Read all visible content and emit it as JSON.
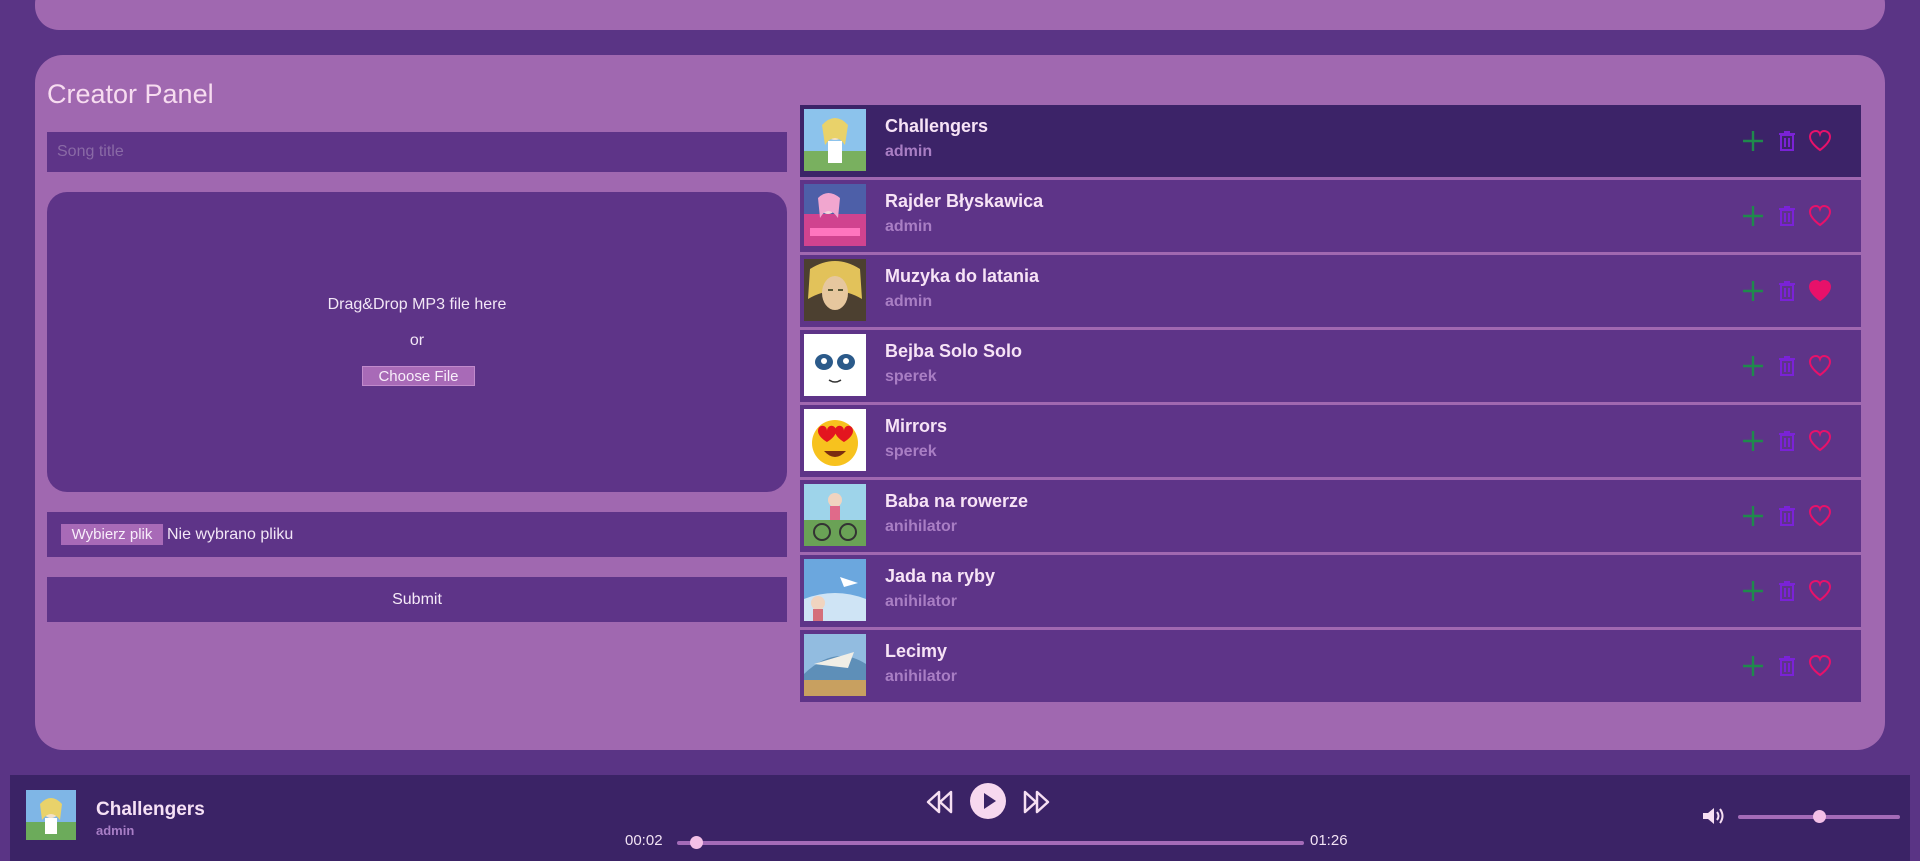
{
  "creator": {
    "title": "Creator Panel",
    "song_title_placeholder": "Song title",
    "dropzone_text": "Drag&Drop MP3 file here",
    "dropzone_or": "or",
    "choose_file_label": "Choose File",
    "file_button_label": "Wybierz plik",
    "file_status": "Nie wybrano pliku",
    "submit_label": "Submit"
  },
  "songs": [
    {
      "title": "Challengers",
      "artist": "admin",
      "liked": false,
      "active": true,
      "thumb": "anime-girl-sky"
    },
    {
      "title": "Rajder Błyskawica",
      "artist": "admin",
      "liked": false,
      "active": false,
      "thumb": "pink-car-girl"
    },
    {
      "title": "Muzyka do latania",
      "artist": "admin",
      "liked": true,
      "active": false,
      "thumb": "blond-man"
    },
    {
      "title": "Bejba Solo Solo",
      "artist": "sperek",
      "liked": false,
      "active": false,
      "thumb": "anime-eyes-face"
    },
    {
      "title": "Mirrors",
      "artist": "sperek",
      "liked": false,
      "active": false,
      "thumb": "heart-eyes-emoji"
    },
    {
      "title": "Baba na rowerze",
      "artist": "anihilator",
      "liked": false,
      "active": false,
      "thumb": "girl-on-bike"
    },
    {
      "title": "Jada na ryby",
      "artist": "anihilator",
      "liked": false,
      "active": false,
      "thumb": "anime-sky-scene"
    },
    {
      "title": "Lecimy",
      "artist": "anihilator",
      "liked": false,
      "active": false,
      "thumb": "flying-scene"
    }
  ],
  "player": {
    "title": "Challengers",
    "artist": "admin",
    "current_time": "00:02",
    "duration": "01:26",
    "progress": 0.03,
    "volume": 0.5
  },
  "colors": {
    "add": "#1f8a4c",
    "delete": "#7a22d6",
    "like": "#e8116a",
    "accent": "#a068b0"
  },
  "icons": {
    "add": "plus-icon",
    "delete": "trash-icon",
    "like": "heart-icon",
    "prev": "rewind-icon",
    "play": "play-icon",
    "next": "fast-forward-icon",
    "volume": "volume-icon"
  }
}
